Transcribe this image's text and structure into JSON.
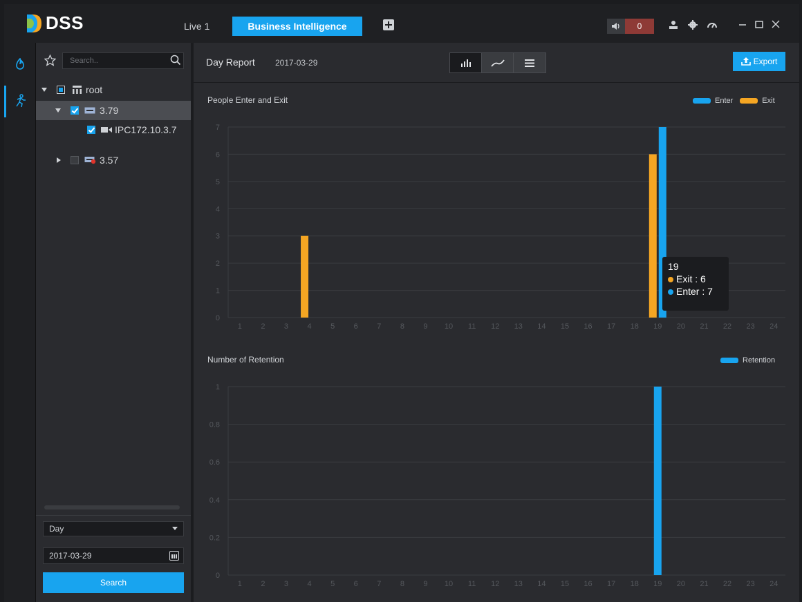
{
  "app": {
    "name": "DSS",
    "tabs": [
      {
        "label": "Live 1"
      },
      {
        "label": "Business Intelligence"
      }
    ],
    "alarm_count": "0",
    "colors": {
      "accent": "#18a4ef",
      "exit": "#f5a623",
      "alarm": "#8e3a36"
    }
  },
  "nav": {
    "items": [
      {
        "icon": "flame-icon"
      },
      {
        "icon": "people-counting-icon"
      }
    ]
  },
  "tree": {
    "search_placeholder": "Search..",
    "nodes": [
      {
        "label": "root",
        "icon": "org-icon",
        "expanded": true,
        "check": "partial"
      },
      {
        "label": "3.79",
        "icon": "nvr-icon",
        "expanded": true,
        "check": "checked"
      },
      {
        "label": "IPC172.10.3.7",
        "icon": "camera-icon",
        "check": "checked"
      },
      {
        "label": "3.57",
        "icon": "nvr-offline-icon",
        "expanded": false,
        "check": "unchecked"
      }
    ]
  },
  "query": {
    "period": "Day",
    "date": "2017-03-29",
    "search_label": "Search"
  },
  "report": {
    "title": "Day Report",
    "date": "2017-03-29",
    "export_label": "Export"
  },
  "chart_data": [
    {
      "type": "bar",
      "title": "People Enter and Exit",
      "categories": [
        "1",
        "2",
        "3",
        "4",
        "5",
        "6",
        "7",
        "8",
        "9",
        "10",
        "11",
        "12",
        "13",
        "14",
        "15",
        "16",
        "17",
        "18",
        "19",
        "20",
        "21",
        "22",
        "23",
        "24"
      ],
      "series": [
        {
          "name": "Exit",
          "color": "#f5a623",
          "values": [
            0,
            0,
            0,
            3,
            0,
            0,
            0,
            0,
            0,
            0,
            0,
            0,
            0,
            0,
            0,
            0,
            0,
            0,
            6,
            0,
            0,
            0,
            0,
            0
          ]
        },
        {
          "name": "Enter",
          "color": "#18a4ef",
          "values": [
            0,
            0,
            0,
            0,
            0,
            0,
            0,
            0,
            0,
            0,
            0,
            0,
            0,
            0,
            0,
            0,
            0,
            0,
            7,
            0,
            0,
            0,
            0,
            0
          ]
        }
      ],
      "legend": [
        "Enter",
        "Exit"
      ],
      "yticks": [
        "0",
        "1",
        "2",
        "3",
        "4",
        "5",
        "6",
        "7"
      ],
      "ylim": [
        0,
        7
      ],
      "tooltip": {
        "header": "19",
        "items": [
          {
            "label": "Exit : 6",
            "color": "#f5a623"
          },
          {
            "label": "Enter : 7",
            "color": "#18a4ef"
          }
        ]
      }
    },
    {
      "type": "bar",
      "title": "Number of Retention",
      "categories": [
        "1",
        "2",
        "3",
        "4",
        "5",
        "6",
        "7",
        "8",
        "9",
        "10",
        "11",
        "12",
        "13",
        "14",
        "15",
        "16",
        "17",
        "18",
        "19",
        "20",
        "21",
        "22",
        "23",
        "24"
      ],
      "series": [
        {
          "name": "Retention",
          "color": "#18a4ef",
          "values": [
            0,
            0,
            0,
            0,
            0,
            0,
            0,
            0,
            0,
            0,
            0,
            0,
            0,
            0,
            0,
            0,
            0,
            0,
            1,
            0,
            0,
            0,
            0,
            0
          ]
        }
      ],
      "legend": [
        "Retention"
      ],
      "yticks": [
        "0",
        "0.2",
        "0.4",
        "0.6",
        "0.8",
        "1"
      ],
      "ylim": [
        0,
        1
      ]
    }
  ]
}
